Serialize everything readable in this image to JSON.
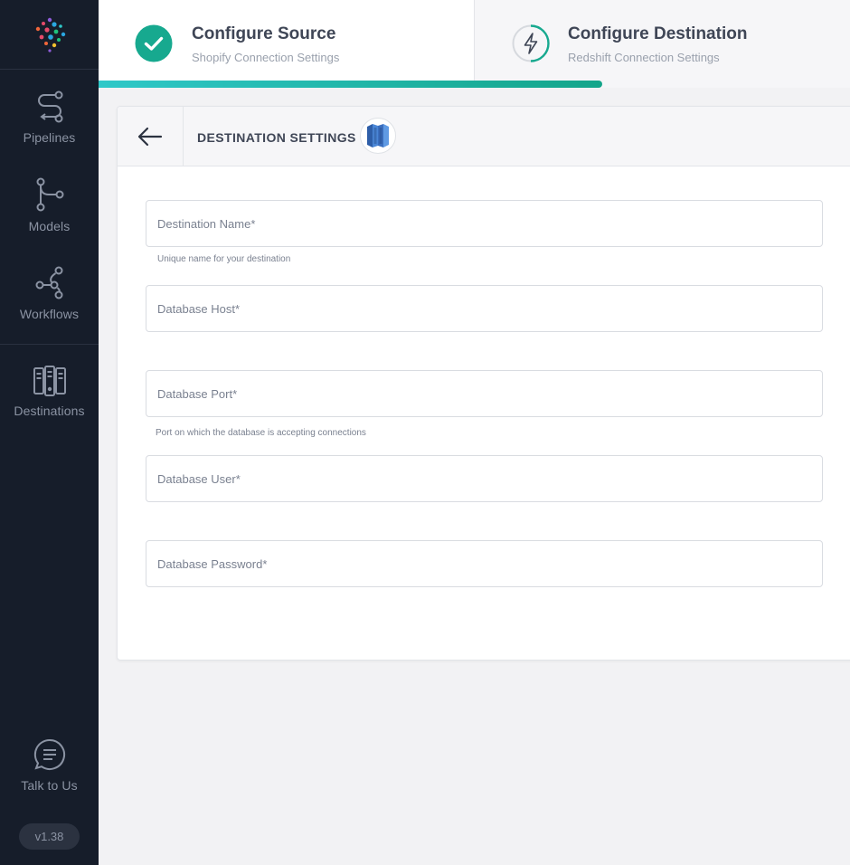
{
  "sidebar": {
    "items": [
      {
        "label": "Pipelines",
        "icon": "pipelines-icon"
      },
      {
        "label": "Models",
        "icon": "models-icon"
      },
      {
        "label": "Workflows",
        "icon": "workflows-icon"
      },
      {
        "label": "Destinations",
        "icon": "destinations-icon"
      }
    ],
    "talk_label": "Talk to Us",
    "version": "v1.38"
  },
  "stepper": {
    "step1": {
      "title": "Configure Source",
      "subtitle": "Shopify Connection Settings",
      "status": "complete"
    },
    "step2": {
      "title": "Configure Destination",
      "subtitle": "Redshift Connection Settings",
      "status": "active"
    },
    "progress_fraction": 0.67
  },
  "card": {
    "title": "DESTINATION SETTINGS",
    "logo_icon": "redshift-logo-icon"
  },
  "form": {
    "destination_name": {
      "placeholder": "Destination Name*",
      "value": "",
      "hint": "Unique name for your destination"
    },
    "db_host": {
      "placeholder": "Database Host*",
      "value": ""
    },
    "db_port": {
      "placeholder": "Database Port*",
      "value": "",
      "hint": "Port on which the database is accepting connections"
    },
    "db_user": {
      "placeholder": "Database User*",
      "value": ""
    },
    "db_password": {
      "placeholder": "Database Password*",
      "value": ""
    }
  },
  "colors": {
    "sidebar_bg": "#161d2a",
    "accent": "#17a98f",
    "accent_light": "#2fc8c8",
    "text_dark": "#3f4656",
    "redshift_blue": "#3b6fbf"
  }
}
